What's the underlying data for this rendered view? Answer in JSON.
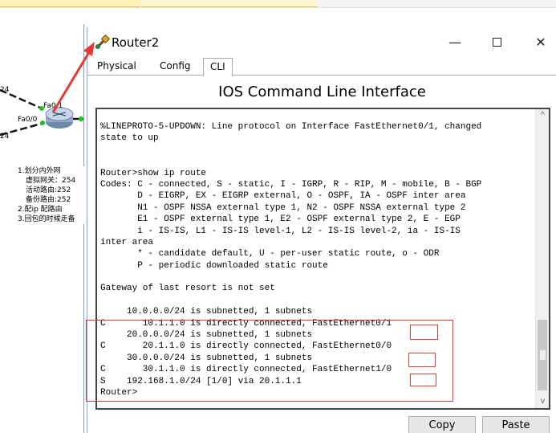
{
  "window": {
    "title": "Router2",
    "minimize": "—",
    "close": "✕"
  },
  "tabs": [
    {
      "label": "Physical",
      "active": false
    },
    {
      "label": "Config",
      "active": false
    },
    {
      "label": "CLI",
      "active": true
    }
  ],
  "cli": {
    "heading": "IOS Command Line Interface",
    "lines": [
      "%LINEPROTO-5-UPDOWN: Line protocol on Interface FastEthernet0/1, changed",
      "state to up",
      "",
      "",
      "Router>show ip route",
      "Codes: C - connected, S - static, I - IGRP, R - RIP, M - mobile, B - BGP",
      "       D - EIGRP, EX - EIGRP external, O - OSPF, IA - OSPF inter area",
      "       N1 - OSPF NSSA external type 1, N2 - OSPF NSSA external type 2",
      "       E1 - OSPF external type 1, E2 - OSPF external type 2, E - EGP",
      "       i - IS-IS, L1 - IS-IS level-1, L2 - IS-IS level-2, ia - IS-IS",
      "inter area",
      "       * - candidate default, U - per-user static route, o - ODR",
      "       P - periodic downloaded static route",
      "",
      "Gateway of last resort is not set",
      "",
      "     10.0.0.0/24 is subnetted, 1 subnets",
      "C       10.1.1.0 is directly connected, FastEthernet0/1",
      "     20.0.0.0/24 is subnetted, 1 subnets",
      "C       20.1.1.0 is directly connected, FastEthernet0/0",
      "     30.0.0.0/24 is subnetted, 1 subnets",
      "C       30.1.1.0 is directly connected, FastEthernet1/0",
      "S    192.168.1.0/24 [1/0] via 20.1.1.1",
      "Router>"
    ]
  },
  "buttons": {
    "copy": "Copy",
    "paste": "Paste"
  },
  "topology": {
    "port_fa01": "Fa0/1",
    "port_fa00": "Fa0/0",
    "edge_label_1": "24",
    "edge_label_2": "24"
  },
  "notes": {
    "line1": "1.划分内外网",
    "line2": "虚拟网关：254",
    "line3": "活动路由:252",
    "line4": "备份路由:252",
    "line5": "2.配ip 配路由",
    "line6": "3.回包的时候走备"
  },
  "colors": {
    "annotation_red": "#e53935",
    "window_border": "#8ba7cf"
  }
}
